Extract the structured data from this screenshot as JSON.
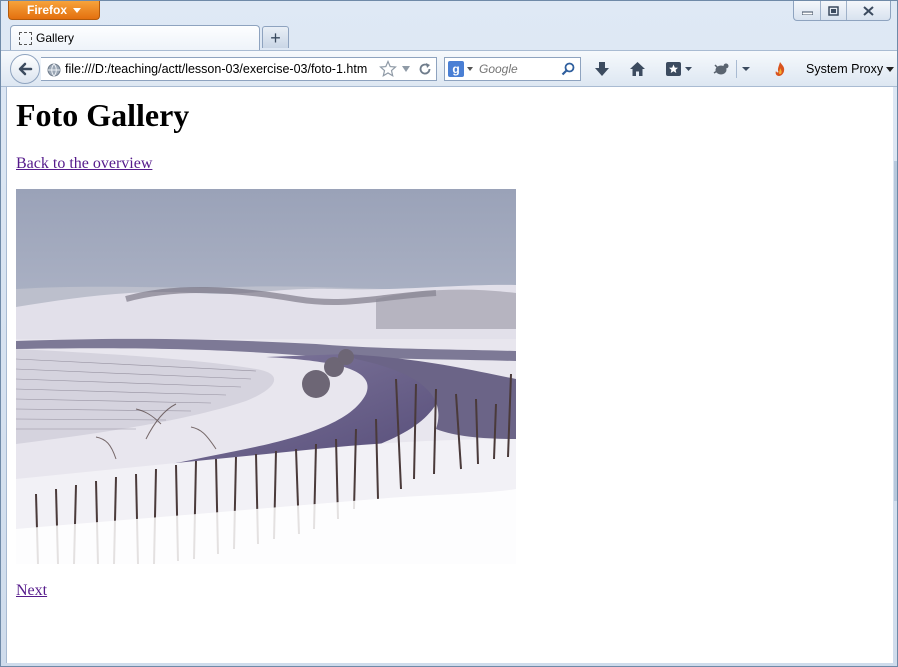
{
  "browser": {
    "app_button_label": "Firefox",
    "tab": {
      "title": "Gallery"
    },
    "new_tab_label": "+",
    "url": "file:///D:/teaching/actt/lesson-03/exercise-03/foto-1.htm",
    "search": {
      "engine_icon": "g-icon",
      "placeholder": "Google"
    },
    "proxy_label": "System Proxy"
  },
  "page": {
    "heading": "Foto Gallery",
    "back_link": "Back to the overview",
    "next_link": "Next"
  },
  "colors": {
    "link_visited": "#551a8b",
    "firefox_orange": "#e3700f"
  }
}
